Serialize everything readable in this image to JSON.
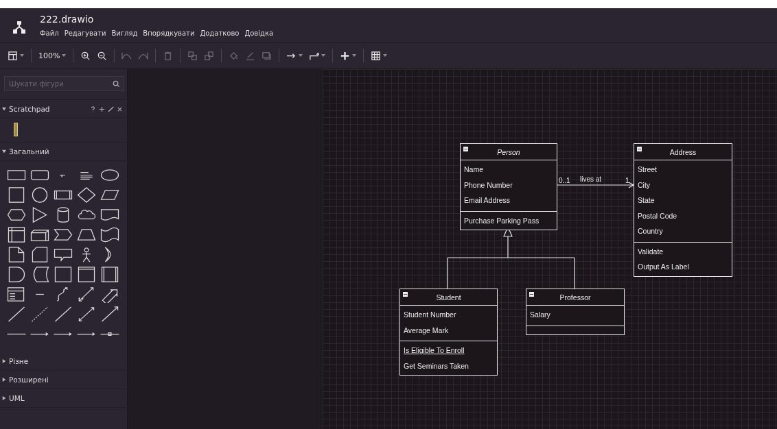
{
  "window": {
    "title": "222.drawio"
  },
  "menu": [
    "Файл",
    "Редагувати",
    "Вигляд",
    "Впорядкувати",
    "Додатково",
    "Довідка"
  ],
  "toolbar": {
    "zoom": "100%",
    "tools": [
      {
        "kind": "panel",
        "disabled": false,
        "dropdown": true
      },
      {
        "kind": "sep"
      },
      {
        "kind": "zoomtext",
        "disabled": false,
        "dropdown": true
      },
      {
        "kind": "sep"
      },
      {
        "kind": "zoom-in",
        "disabled": false,
        "dropdown": false
      },
      {
        "kind": "zoom-out",
        "disabled": false,
        "dropdown": false
      },
      {
        "kind": "sep"
      },
      {
        "kind": "undo",
        "disabled": true,
        "dropdown": false
      },
      {
        "kind": "redo",
        "disabled": true,
        "dropdown": false
      },
      {
        "kind": "sep"
      },
      {
        "kind": "delete",
        "disabled": true,
        "dropdown": false
      },
      {
        "kind": "sep"
      },
      {
        "kind": "to-front",
        "disabled": true,
        "dropdown": false
      },
      {
        "kind": "to-back",
        "disabled": true,
        "dropdown": false
      },
      {
        "kind": "sep"
      },
      {
        "kind": "fill",
        "disabled": true,
        "dropdown": false
      },
      {
        "kind": "line-color",
        "disabled": true,
        "dropdown": false
      },
      {
        "kind": "shadow",
        "disabled": true,
        "dropdown": false
      },
      {
        "kind": "sep"
      },
      {
        "kind": "connection",
        "disabled": false,
        "dropdown": true
      },
      {
        "kind": "waypoints",
        "disabled": false,
        "dropdown": true
      },
      {
        "kind": "sep"
      },
      {
        "kind": "insert",
        "disabled": false,
        "dropdown": true
      },
      {
        "kind": "sep"
      },
      {
        "kind": "table",
        "disabled": false,
        "dropdown": true
      }
    ]
  },
  "sidebar": {
    "search": {
      "placeholder": "Шукати фігури"
    },
    "sections": [
      {
        "kind": "scratchpad",
        "title": "Scratchpad",
        "expanded": true
      },
      {
        "kind": "shapes",
        "title": "Загальний",
        "expanded": true
      },
      {
        "kind": "library",
        "title": "Різне",
        "expanded": false
      },
      {
        "kind": "library",
        "title": "Розширені",
        "expanded": false
      },
      {
        "kind": "library",
        "title": "UML",
        "expanded": false
      }
    ]
  },
  "diagram": {
    "classes": [
      {
        "name": "Person",
        "abstract": true,
        "attributes": [
          "Name",
          "Phone Number",
          "Email Address"
        ],
        "operations": [
          {
            "name": "Purchase Parking Pass",
            "static": false
          }
        ]
      },
      {
        "name": "Address",
        "abstract": false,
        "attributes": [
          "Street",
          "City",
          "State",
          "Postal Code",
          "Country"
        ],
        "operations": [
          {
            "name": "Validate",
            "static": false
          },
          {
            "name": "Output As Label",
            "static": false
          }
        ]
      },
      {
        "name": "Student",
        "abstract": false,
        "attributes": [
          "Student Number",
          "Average Mark"
        ],
        "operations": [
          {
            "name": "Is Eligible To Enroll",
            "static": true
          },
          {
            "name": "Get Seminars Taken",
            "static": false
          }
        ]
      },
      {
        "name": "Professor",
        "abstract": false,
        "attributes": [
          "Salary"
        ]
      }
    ],
    "association": {
      "label": "lives at",
      "source_multiplicity": "0..1",
      "target_multiplicity": "1"
    }
  }
}
